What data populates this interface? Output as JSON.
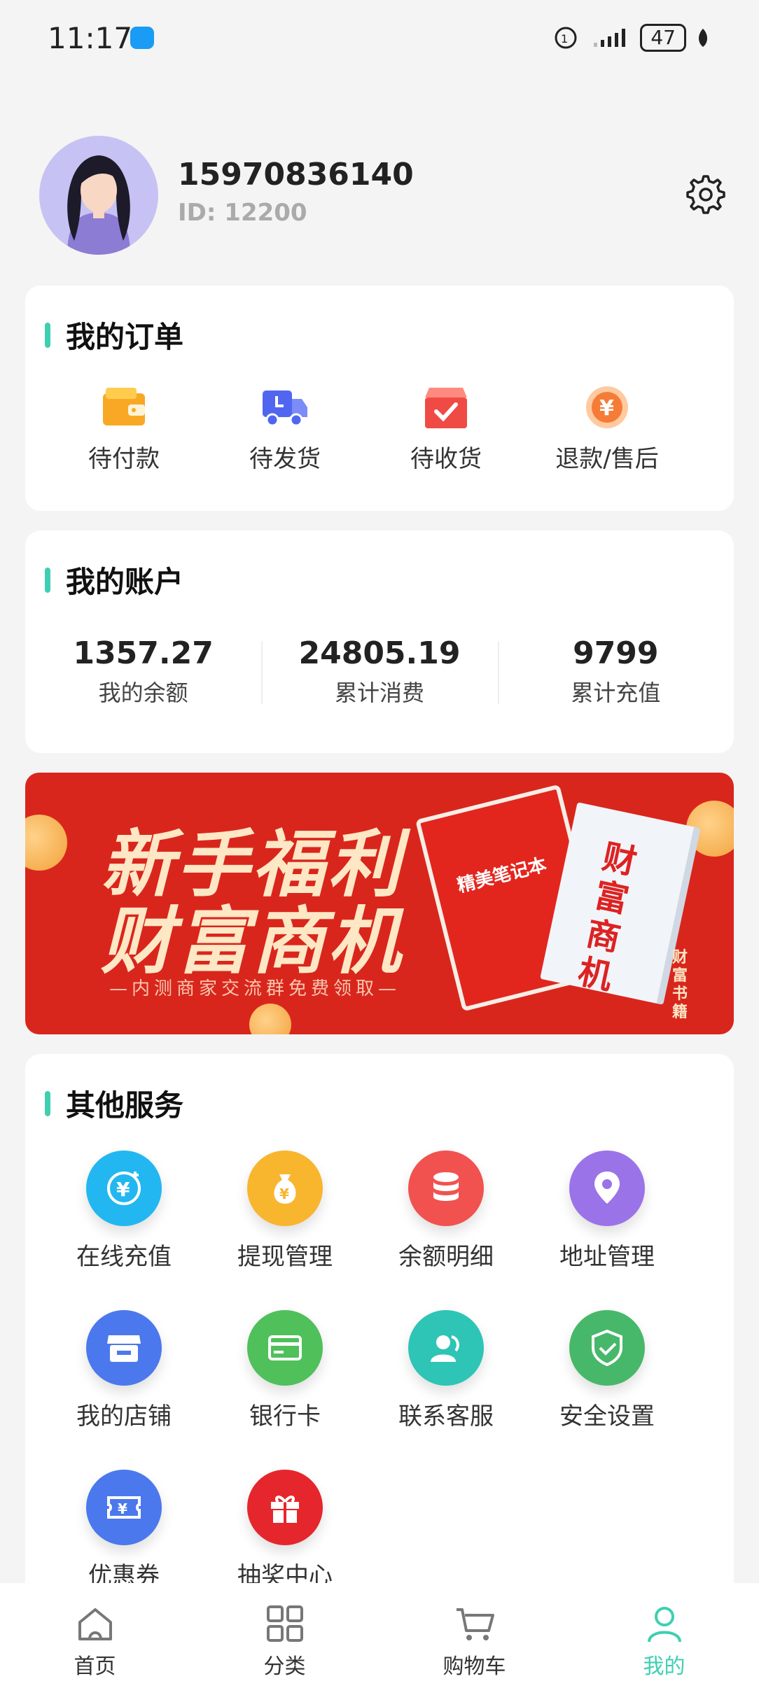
{
  "status_bar": {
    "time": "11:17",
    "battery": "47"
  },
  "profile": {
    "phone": "15970836140",
    "id": "ID: 12200"
  },
  "orders": {
    "title": "我的订单",
    "items": [
      {
        "label": "待付款",
        "icon": "wallet-icon"
      },
      {
        "label": "待发货",
        "icon": "truck-icon"
      },
      {
        "label": "待收货",
        "icon": "box-check-icon"
      },
      {
        "label": "退款/售后",
        "icon": "refund-icon"
      }
    ]
  },
  "account": {
    "title": "我的账户",
    "items": [
      {
        "value": "1357.27",
        "label": "我的余额"
      },
      {
        "value": "24805.19",
        "label": "累计消费"
      },
      {
        "value": "9799",
        "label": "累计充值"
      }
    ]
  },
  "banner": {
    "line1": "新手福利",
    "line2": "财富商机",
    "subtitle": "—内测商家交流群免费领取—",
    "book1_title": "精美笔记本",
    "book2_title": "财富商机",
    "side_text": "财富书籍"
  },
  "services": {
    "title": "其他服务",
    "items": [
      {
        "label": "在线充值",
        "icon": "recharge-icon",
        "color": "#22b7f0"
      },
      {
        "label": "提现管理",
        "icon": "money-bag-icon",
        "color": "#f8b52e"
      },
      {
        "label": "余额明细",
        "icon": "database-icon",
        "color": "#f1524f"
      },
      {
        "label": "地址管理",
        "icon": "location-icon",
        "color": "#9b73e8"
      },
      {
        "label": "我的店铺",
        "icon": "store-icon",
        "color": "#4b78ec"
      },
      {
        "label": "银行卡",
        "icon": "bank-card-icon",
        "color": "#4fc05a"
      },
      {
        "label": "联系客服",
        "icon": "customer-service-icon",
        "color": "#2ec4b6"
      },
      {
        "label": "安全设置",
        "icon": "shield-icon",
        "color": "#47b86a"
      },
      {
        "label": "优惠券",
        "icon": "coupon-icon",
        "color": "#4b78ec"
      },
      {
        "label": "抽奖中心",
        "icon": "gift-icon",
        "color": "#e5262c"
      }
    ]
  },
  "tabbar": {
    "items": [
      {
        "label": "首页",
        "icon": "home-icon"
      },
      {
        "label": "分类",
        "icon": "grid-icon"
      },
      {
        "label": "购物车",
        "icon": "cart-icon"
      },
      {
        "label": "我的",
        "icon": "user-icon"
      }
    ],
    "active": "我的",
    "accent": "#3ecfb2"
  }
}
